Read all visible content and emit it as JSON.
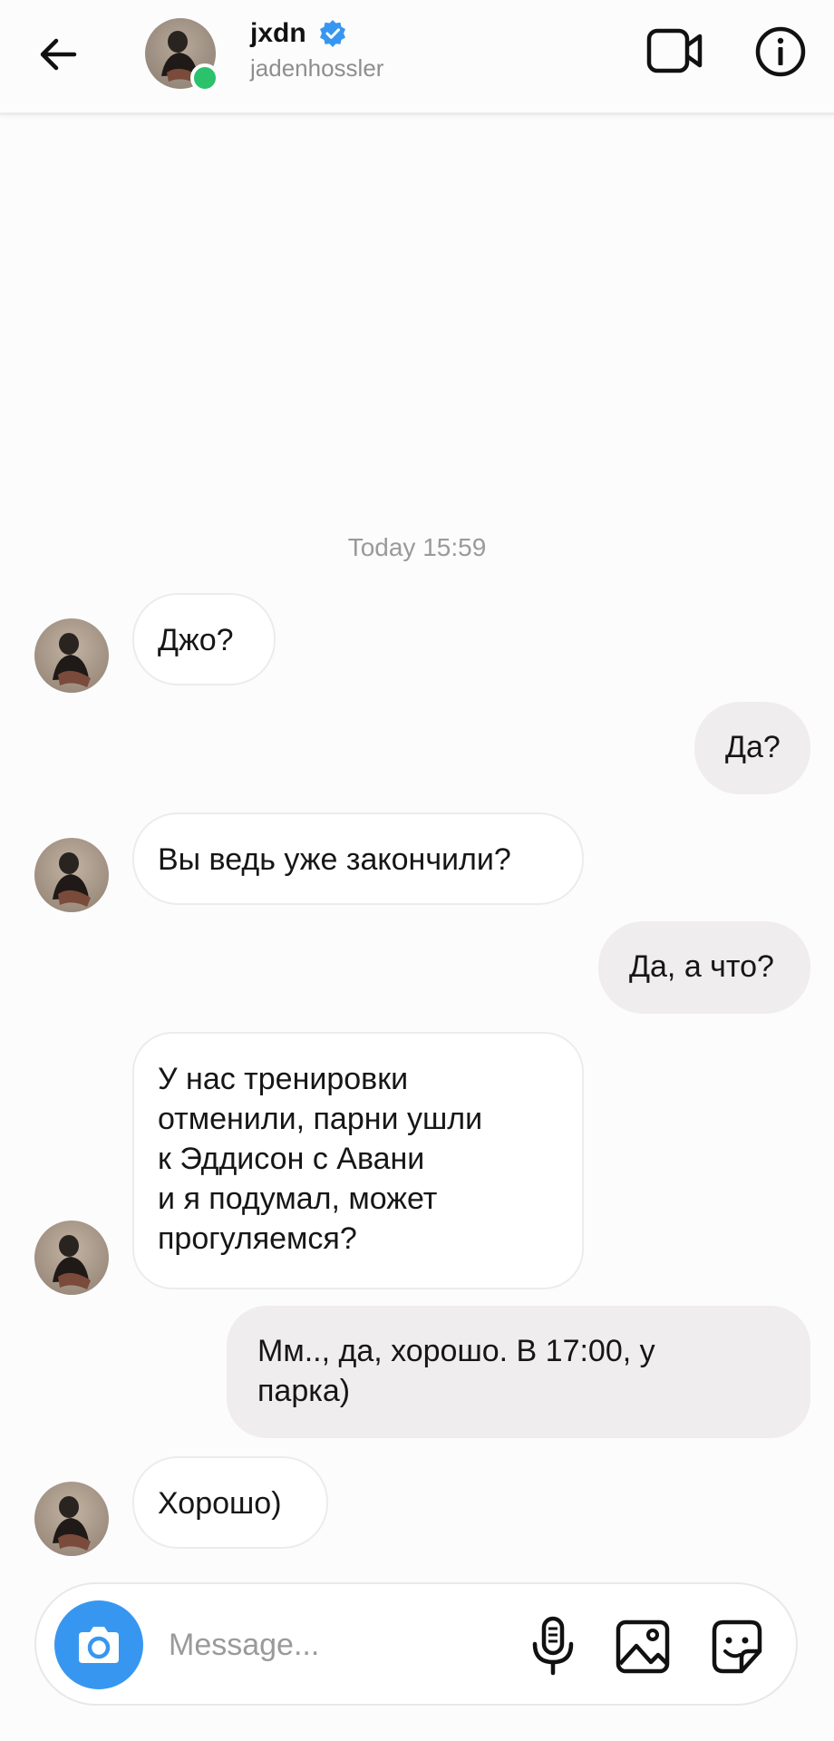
{
  "header": {
    "title": "jxdn",
    "subtitle": "jadenhossler",
    "verified": true,
    "online": true,
    "icons": [
      "back-arrow-icon",
      "verified-badge-icon",
      "video-call-icon",
      "info-icon"
    ],
    "accent_color": "#3797f0",
    "online_color": "#2bc26b"
  },
  "conversation": {
    "timestamp": "Today 15:59",
    "messages": [
      {
        "from": "them",
        "text": "Джо?"
      },
      {
        "from": "me",
        "text": "Да?"
      },
      {
        "from": "them",
        "text": "Вы ведь уже закончили?"
      },
      {
        "from": "me",
        "text": "Да, а что?"
      },
      {
        "from": "them",
        "lines": [
          "У нас тренировки",
          "отменили, парни ушли",
          "к Эддисон с Авани",
          "и я подумал, может",
          "прогуляемся?"
        ]
      },
      {
        "from": "me",
        "lines": [
          "Мм.., да,  хорошо. В 17:00, у",
          "парка)"
        ]
      },
      {
        "from": "them",
        "text": "Хорошо)"
      }
    ]
  },
  "composer": {
    "placeholder": "Message...",
    "value": "",
    "icons": [
      "camera-icon",
      "microphone-icon",
      "gallery-icon",
      "sticker-icon"
    ]
  }
}
